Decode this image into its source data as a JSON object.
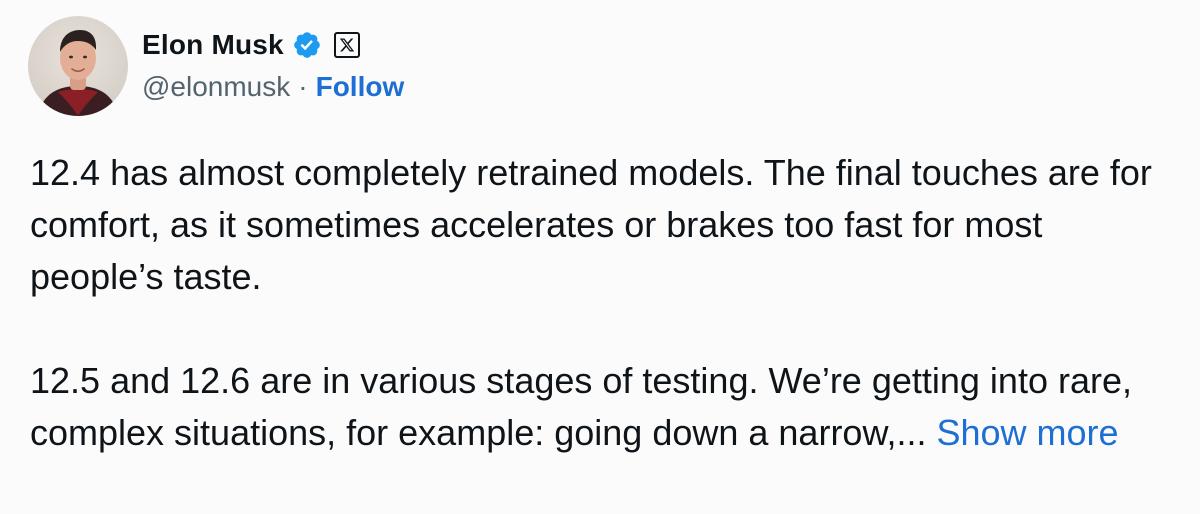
{
  "author": {
    "display_name": "Elon Musk",
    "handle": "@elonmusk",
    "separator": "·",
    "follow_label": "Follow",
    "verified_badge_icon": "verified-check-icon",
    "platform_icon": "x-logo-icon",
    "verified_color": "#1d9bf0"
  },
  "tweet": {
    "paragraph_1": "12.4 has almost completely retrained models. The final touches are for comfort, as it sometimes accelerates or brakes too fast for most people’s taste.",
    "paragraph_2": "12.5 and 12.6 are in various stages of testing. We’re getting into rare, complex situations, for example: going down a narrow,...",
    "show_more_label": "Show more"
  },
  "colors": {
    "link": "#1d6fd4",
    "text": "#0f1419",
    "muted": "#536471"
  }
}
